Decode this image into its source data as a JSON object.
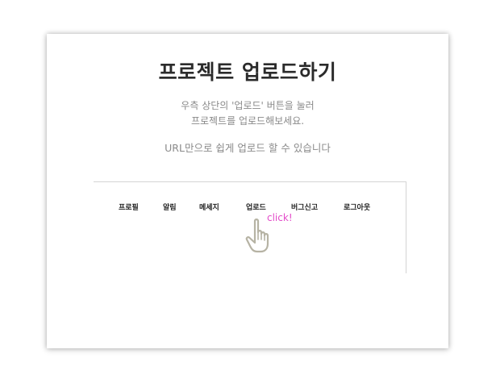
{
  "page": {
    "title": "프로젝트 업로드하기",
    "description_line1": "우측 상단의 '업로드' 버튼을 눌러",
    "description_line2": "프로젝트를 업로드해보세요.",
    "description_line3": "URL만으로 쉽게 업로드 할 수 있습니다"
  },
  "menu": {
    "items": [
      {
        "label": "프로필"
      },
      {
        "label": "알림"
      },
      {
        "label": "메세지"
      },
      {
        "label": "업로드"
      },
      {
        "label": "버그신고"
      },
      {
        "label": "로그아웃"
      }
    ]
  },
  "cursor": {
    "annotation": "click!",
    "icon": "pointing-hand-icon",
    "annotation_color": "#e34bc9"
  }
}
